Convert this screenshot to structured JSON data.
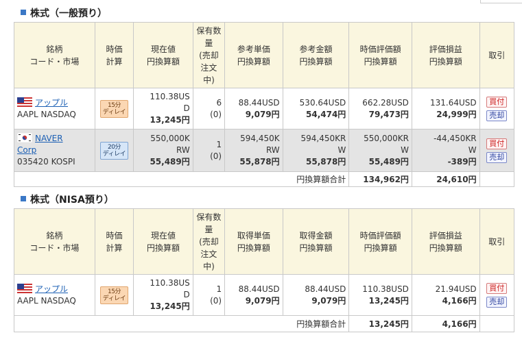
{
  "sections": [
    {
      "title": "株式（一般預り）",
      "headers": {
        "name": [
          "銘柄",
          "コード・市場"
        ],
        "time": [
          "時価",
          "計算"
        ],
        "price": [
          "現在値",
          "円換算額"
        ],
        "qty": [
          "保有数",
          "量",
          "(売却",
          "注文",
          "中)"
        ],
        "unit": [
          "参考単価",
          "円換算額"
        ],
        "amount": [
          "参考金額",
          "円換算額"
        ],
        "value": [
          "時価評価額",
          "円換算額"
        ],
        "pl": [
          "評価損益",
          "円換算額"
        ],
        "trade": "取引"
      },
      "rows": [
        {
          "name": "アップル",
          "code": "AAPL NASDAQ",
          "flag": "us-flag-icon",
          "delay": [
            "15分",
            "ディレイ"
          ],
          "price": [
            "110.38US",
            "D"
          ],
          "price_jpy": "13,245円",
          "qty": "6",
          "qty_pending": "(0)",
          "unit": [
            "88.44USD"
          ],
          "unit_jpy": "9,079円",
          "amount": [
            "530.64USD"
          ],
          "amount_jpy": "54,474円",
          "value": [
            "662.28USD"
          ],
          "value_jpy": "79,473円",
          "pl": [
            "131.64USD"
          ],
          "pl_jpy": "24,999円",
          "buy": "買付",
          "sell": "売却"
        },
        {
          "name": "NAVER Corp",
          "name_lines": [
            "NAVER",
            "Corp"
          ],
          "code": "035420 KOSPI",
          "flag": "kr-flag-icon",
          "delay": [
            "20分",
            "ディレイ"
          ],
          "price": [
            "550,000K",
            "RW"
          ],
          "price_jpy": "55,489円",
          "qty": "1",
          "qty_pending": "(0)",
          "unit": [
            "594,450K",
            "RW"
          ],
          "unit_jpy": "55,878円",
          "amount": [
            "594,450KR",
            "W"
          ],
          "amount_jpy": "55,878円",
          "value": [
            "550,000KR",
            "W"
          ],
          "value_jpy": "55,489円",
          "pl": [
            "-44,450KR",
            "W"
          ],
          "pl_jpy": "-389円",
          "buy": "買付",
          "sell": "売却"
        }
      ],
      "summary": {
        "label": "円換算額合計",
        "value_total": "134,962円",
        "pl_total": "24,610円"
      }
    },
    {
      "title": "株式（NISA預り）",
      "headers": {
        "name": [
          "銘柄",
          "コード・市場"
        ],
        "time": [
          "時価",
          "計算"
        ],
        "price": [
          "現在値",
          "円換算額"
        ],
        "qty": [
          "保有数",
          "量",
          "(売却",
          "注文",
          "中)"
        ],
        "unit": [
          "取得単価",
          "円換算額"
        ],
        "amount": [
          "取得金額",
          "円換算額"
        ],
        "value": [
          "時価評価額",
          "円換算額"
        ],
        "pl": [
          "評価損益",
          "円換算額"
        ],
        "trade": "取引"
      },
      "rows": [
        {
          "name": "アップル",
          "code": "AAPL NASDAQ",
          "flag": "us-flag-icon",
          "delay": [
            "15分",
            "ディレイ"
          ],
          "price": [
            "110.38US",
            "D"
          ],
          "price_jpy": "13,245円",
          "qty": "1",
          "qty_pending": "(0)",
          "unit": [
            "88.44USD"
          ],
          "unit_jpy": "9,079円",
          "amount": [
            "88.44USD"
          ],
          "amount_jpy": "9,079円",
          "value": [
            "110.38USD"
          ],
          "value_jpy": "13,245円",
          "pl": [
            "21.94USD"
          ],
          "pl_jpy": "4,166円",
          "buy": "買付",
          "sell": "売却"
        }
      ],
      "summary": {
        "label": "円換算額合計",
        "value_total": "13,245円",
        "pl_total": "4,166円"
      }
    }
  ],
  "colors": {
    "header_bg": "#faf6df",
    "alt_row_bg": "#e4e4e4",
    "link": "#1b5fb4",
    "buy": "#cc2222",
    "sell": "#2a3f9c"
  }
}
